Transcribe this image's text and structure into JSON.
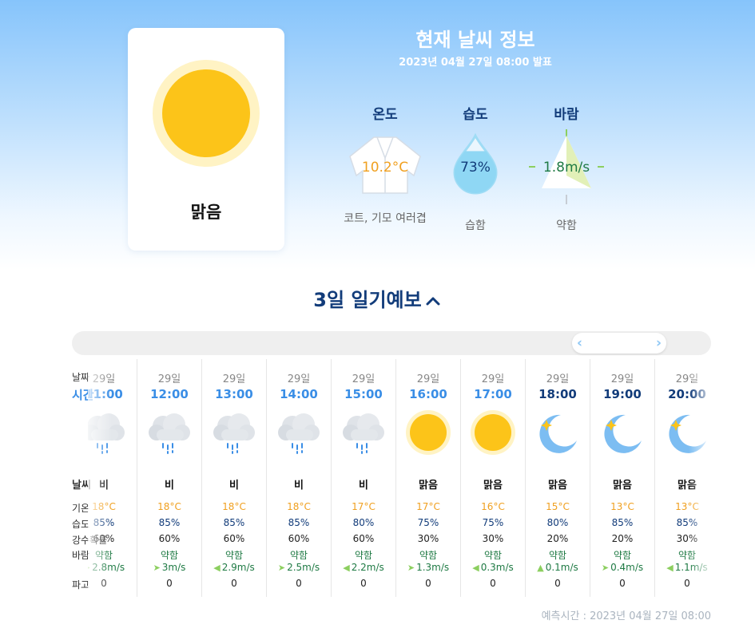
{
  "current": {
    "condition": "맑음",
    "title": "현재 날씨 정보",
    "issued": "2023년 04월 27일 08:00 발표",
    "temperature": {
      "label": "온도",
      "value": "10.2°C",
      "advice": "코트, 기모 여러겹",
      "icon": "jacket-icon"
    },
    "humidity": {
      "label": "습도",
      "value": "73%",
      "level": 73,
      "desc": "습함",
      "icon": "water-drop-icon"
    },
    "wind": {
      "label": "바람",
      "value": "1.8m/s",
      "desc": "약함",
      "icon": "wind-vane-icon"
    }
  },
  "forecast": {
    "title": "3일 일기예보",
    "row_labels": {
      "date": "날짜",
      "time": "시간",
      "weather": "날씨",
      "temp": "기온",
      "humidity": "습도",
      "precip": "강수확률",
      "wind": "바람",
      "wave": "파고"
    },
    "hours": [
      {
        "day": "29일",
        "time": "11:00",
        "icon": "rain-cloud",
        "weather": "비",
        "temp": "18°C",
        "humidity": "85%",
        "precip": "60%",
        "wind": "약함",
        "speed": "2.8m/s",
        "wave": "0"
      },
      {
        "day": "29일",
        "time": "12:00",
        "icon": "rain-cloud",
        "weather": "비",
        "temp": "18°C",
        "humidity": "85%",
        "precip": "60%",
        "wind": "약함",
        "speed": "3m/s",
        "wave": "0"
      },
      {
        "day": "29일",
        "time": "13:00",
        "icon": "rain-cloud",
        "weather": "비",
        "temp": "18°C",
        "humidity": "85%",
        "precip": "60%",
        "wind": "약함",
        "speed": "2.9m/s",
        "wave": "0"
      },
      {
        "day": "29일",
        "time": "14:00",
        "icon": "rain-cloud",
        "weather": "비",
        "temp": "18°C",
        "humidity": "85%",
        "precip": "60%",
        "wind": "약함",
        "speed": "2.5m/s",
        "wave": "0"
      },
      {
        "day": "29일",
        "time": "15:00",
        "icon": "rain-cloud",
        "weather": "비",
        "temp": "17°C",
        "humidity": "80%",
        "precip": "60%",
        "wind": "약함",
        "speed": "2.2m/s",
        "wave": "0"
      },
      {
        "day": "29일",
        "time": "16:00",
        "icon": "sun",
        "weather": "맑음",
        "temp": "17°C",
        "humidity": "75%",
        "precip": "30%",
        "wind": "약함",
        "speed": "1.3m/s",
        "wave": "0"
      },
      {
        "day": "29일",
        "time": "17:00",
        "icon": "sun",
        "weather": "맑음",
        "temp": "16°C",
        "humidity": "75%",
        "precip": "30%",
        "wind": "약함",
        "speed": "0.3m/s",
        "wave": "0"
      },
      {
        "day": "29일",
        "time": "18:00",
        "icon": "moon",
        "weather": "맑음",
        "temp": "15°C",
        "humidity": "80%",
        "precip": "20%",
        "wind": "약함",
        "speed": "0.1m/s",
        "wave": "0"
      },
      {
        "day": "29일",
        "time": "19:00",
        "icon": "moon",
        "weather": "맑음",
        "temp": "13°C",
        "humidity": "85%",
        "precip": "20%",
        "wind": "약함",
        "speed": "0.4m/s",
        "wave": "0"
      },
      {
        "day": "29일",
        "time": "20:00",
        "icon": "moon",
        "weather": "맑음",
        "temp": "13°C",
        "humidity": "85%",
        "precip": "30%",
        "wind": "약함",
        "speed": "1.1m/s",
        "wave": "0"
      }
    ]
  },
  "footer": "예측시간 : 2023년 04월 27일 08:00",
  "colors": {
    "accent": "#3a8ee6",
    "navy": "#123c7a",
    "temp": "#f0a020",
    "wind": "#1f7a44",
    "sun": "#fcc419"
  }
}
